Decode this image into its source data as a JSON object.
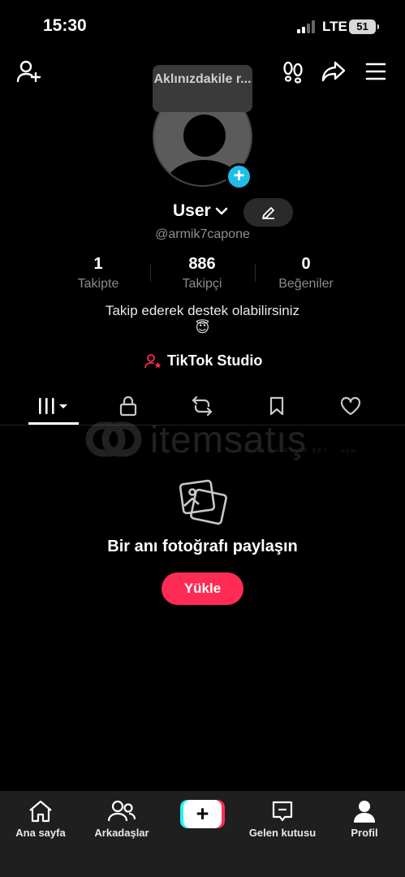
{
  "status_bar": {
    "time": "15:30",
    "network": "LTE",
    "battery": "51"
  },
  "profile": {
    "note_bubble": "Aklınızdakile r...",
    "username": "User",
    "handle": "@armik7capone",
    "stats": [
      {
        "value": "1",
        "label": "Takipte"
      },
      {
        "value": "886",
        "label": "Takipçi"
      },
      {
        "value": "0",
        "label": "Beğeniler"
      }
    ],
    "bio": "Takip ederek destek olabilirsiniz",
    "bio_emoji": "😇",
    "studio_link": "TikTok Studio"
  },
  "tabs": [
    "videos-grid-icon",
    "lock-icon",
    "repost-icon",
    "bookmark-icon",
    "heart-icon"
  ],
  "watermark": {
    "text": "itemsatış",
    "sub": "OYUNA DAİR HER ŞEY · .com"
  },
  "empty_state": {
    "message": "Bir anı fotoğrafı paylaşın",
    "button": "Yükle"
  },
  "bottom_nav": {
    "home": "Ana sayfa",
    "friends": "Arkadaşlar",
    "inbox": "Gelen kutusu",
    "profile": "Profil"
  },
  "colors": {
    "accent": "#fe2c55",
    "cyan": "#25f4ee",
    "plus_badge": "#20bde6"
  }
}
